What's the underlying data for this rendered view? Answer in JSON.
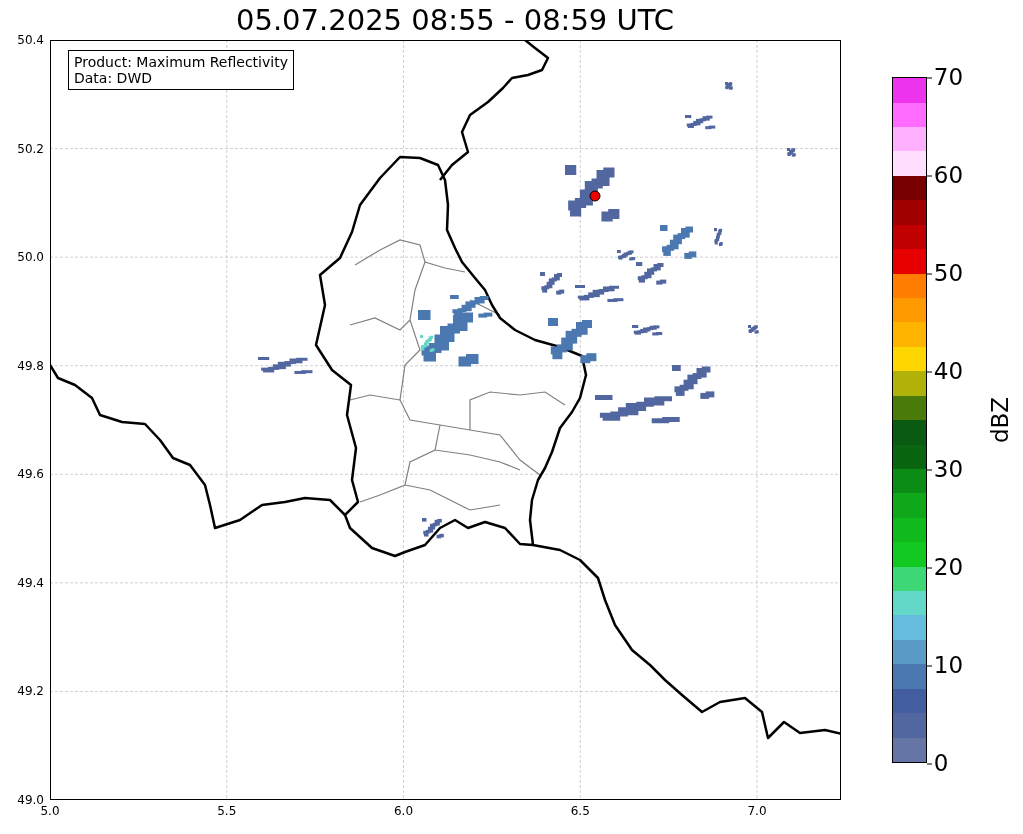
{
  "title": "05.07.2025 08:55 - 08:59 UTC",
  "legend": {
    "lines": [
      "Product: Maximum Reflectivity",
      "Data: DWD"
    ]
  },
  "axes": {
    "xticks": [
      "5.0",
      "5.5",
      "6.0",
      "6.5",
      "7.0"
    ],
    "yticks": [
      "50.4",
      "50.2",
      "50.0",
      "49.8",
      "49.6",
      "49.4",
      "49.2",
      "49.0"
    ]
  },
  "colorbar": {
    "label": "dBZ",
    "ticks": [
      "70",
      "60",
      "50",
      "40",
      "30",
      "20",
      "10",
      "0"
    ],
    "bands": [
      {
        "color": "#6475a6"
      },
      {
        "color": "#52679f"
      },
      {
        "color": "#435ea0"
      },
      {
        "color": "#4b78b0"
      },
      {
        "color": "#5a9bc7"
      },
      {
        "color": "#64bddd"
      },
      {
        "color": "#63d8c8"
      },
      {
        "color": "#3ed776"
      },
      {
        "color": "#12c922"
      },
      {
        "color": "#10b91c"
      },
      {
        "color": "#0ea81a"
      },
      {
        "color": "#0b8c14"
      },
      {
        "color": "#0a6510"
      },
      {
        "color": "#0a5a12"
      },
      {
        "color": "#4a7a0a"
      },
      {
        "color": "#b0b20a"
      },
      {
        "color": "#ffd700"
      },
      {
        "color": "#ffb400"
      },
      {
        "color": "#ff9900"
      },
      {
        "color": "#ff7d00"
      },
      {
        "color": "#e60000"
      },
      {
        "color": "#c00000"
      },
      {
        "color": "#a00000"
      },
      {
        "color": "#780000"
      },
      {
        "color": "#ffdfff"
      },
      {
        "color": "#ffb0ff"
      },
      {
        "color": "#ff6cff"
      },
      {
        "color": "#ee33ee"
      }
    ]
  }
}
